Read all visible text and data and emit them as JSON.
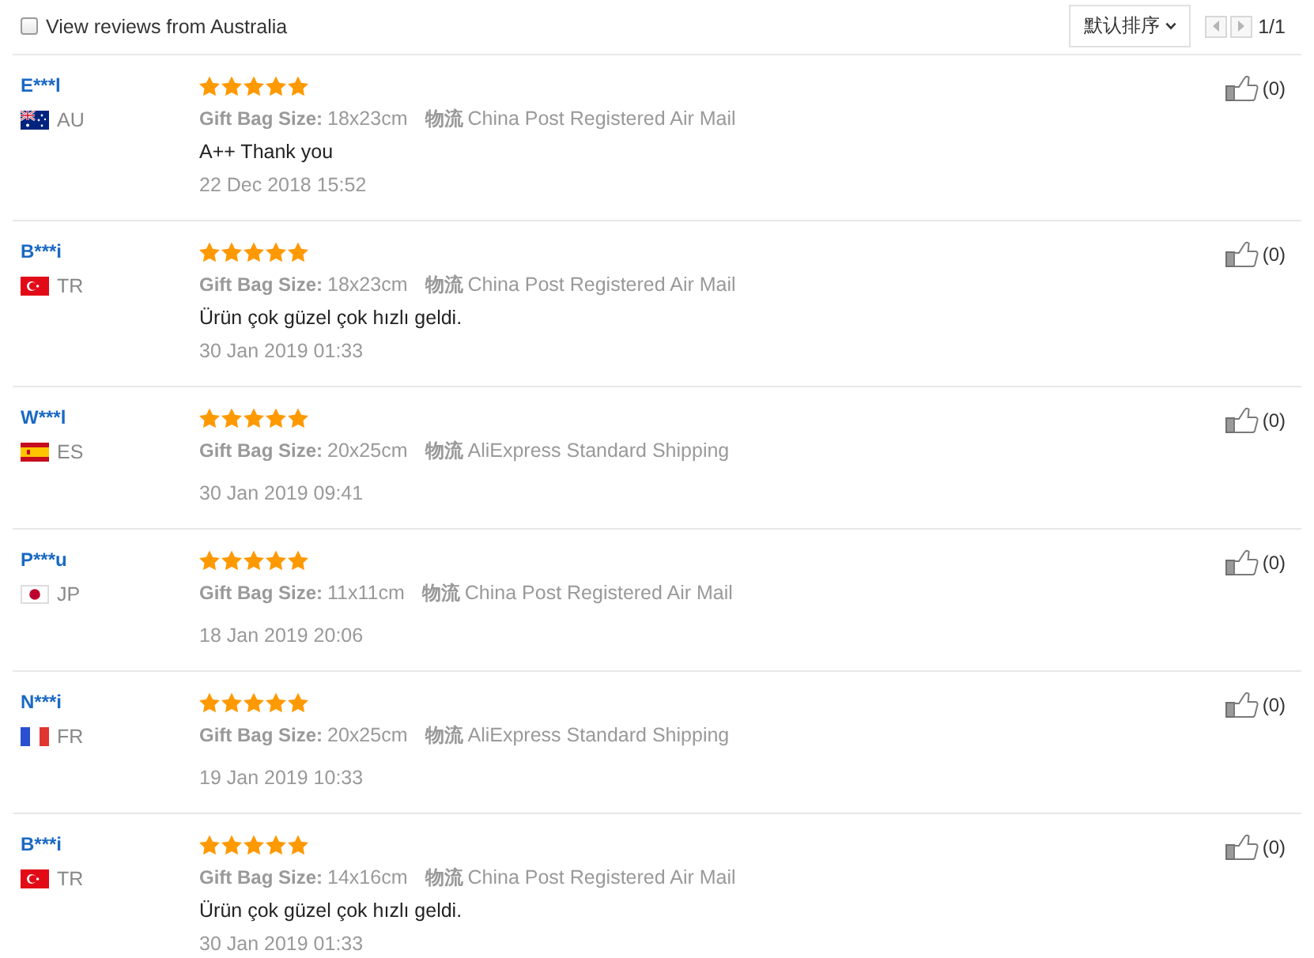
{
  "filter": {
    "label": "View reviews from Australia",
    "checked": false
  },
  "sort": {
    "label": "默认排序"
  },
  "pagination": {
    "page": "1/1"
  },
  "reviews": [
    {
      "user": "E***l",
      "country": "AU",
      "flag": {
        "kind": "au"
      },
      "stars": 5,
      "attributes": [
        {
          "name": "Gift Bag Size:",
          "value": "18x23cm"
        },
        {
          "name": "物流",
          "value": "China Post Registered Air Mail"
        }
      ],
      "text": "A++ Thank you",
      "date": "22 Dec 2018 15:52",
      "helpful": "(0)"
    },
    {
      "user": "B***i",
      "country": "TR",
      "flag": {
        "kind": "tr"
      },
      "stars": 5,
      "attributes": [
        {
          "name": "Gift Bag Size:",
          "value": "18x23cm"
        },
        {
          "name": "物流",
          "value": "China Post Registered Air Mail"
        }
      ],
      "text": "Ürün çok güzel çok hızlı geldi.",
      "date": "30 Jan 2019 01:33",
      "helpful": "(0)"
    },
    {
      "user": "W***l",
      "country": "ES",
      "flag": {
        "kind": "es"
      },
      "stars": 5,
      "attributes": [
        {
          "name": "Gift Bag Size:",
          "value": "20x25cm"
        },
        {
          "name": "物流",
          "value": "AliExpress Standard Shipping"
        }
      ],
      "date": "30 Jan 2019 09:41",
      "helpful": "(0)"
    },
    {
      "user": "P***u",
      "country": "JP",
      "flag": {
        "kind": "jp"
      },
      "stars": 5,
      "attributes": [
        {
          "name": "Gift Bag Size:",
          "value": "11x11cm"
        },
        {
          "name": "物流",
          "value": "China Post Registered Air Mail"
        }
      ],
      "date": "18 Jan 2019 20:06",
      "helpful": "(0)"
    },
    {
      "user": "N***i",
      "country": "FR",
      "flag": {
        "kind": "fr"
      },
      "stars": 5,
      "attributes": [
        {
          "name": "Gift Bag Size:",
          "value": "20x25cm"
        },
        {
          "name": "物流",
          "value": "AliExpress Standard Shipping"
        }
      ],
      "date": "19 Jan 2019 10:33",
      "helpful": "(0)"
    },
    {
      "user": "B***i",
      "country": "TR",
      "flag": {
        "kind": "tr"
      },
      "stars": 5,
      "attributes": [
        {
          "name": "Gift Bag Size:",
          "value": "14x16cm"
        },
        {
          "name": "物流",
          "value": "China Post Registered Air Mail"
        }
      ],
      "text": "Ürün çok güzel çok hızlı geldi.",
      "date": "30 Jan 2019 01:33",
      "helpful": "(0)"
    }
  ]
}
